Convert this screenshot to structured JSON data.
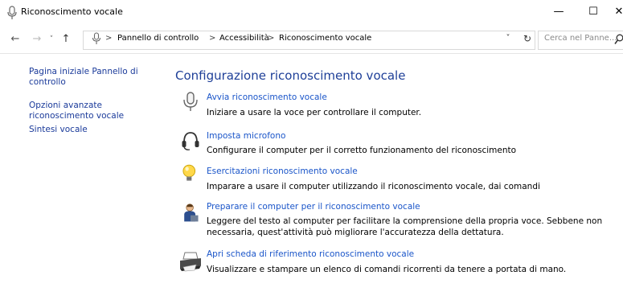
{
  "window": {
    "title": "Riconoscimento vocale",
    "controls": {
      "minimize": "—",
      "maximize": "☐",
      "close": "✕"
    }
  },
  "nav": {
    "back": "←",
    "forward": "→",
    "recent": "˅",
    "up": "↑"
  },
  "address": {
    "separator": ">",
    "crumbs": [
      "Pannello di controllo",
      "Accessibilità",
      "Riconoscimento vocale"
    ],
    "dropdown": "˅",
    "refresh": "↻"
  },
  "search": {
    "placeholder": "Cerca nel Panne..."
  },
  "sidebar": {
    "items": [
      {
        "label": "Pagina iniziale Pannello di controllo"
      },
      {
        "label": "Opzioni avanzate riconoscimento vocale"
      },
      {
        "label": "Sintesi vocale"
      }
    ]
  },
  "main": {
    "title": "Configurazione riconoscimento vocale",
    "tasks": [
      {
        "icon": "microphone-icon",
        "link": "Avvia riconoscimento vocale",
        "desc": "Iniziare a usare la voce per controllare il computer."
      },
      {
        "icon": "headset-icon",
        "link": "Imposta microfono",
        "desc": "Configurare il computer per il corretto funzionamento del riconoscimento"
      },
      {
        "icon": "lightbulb-icon",
        "link": "Esercitazioni riconoscimento vocale",
        "desc": "Imparare a usare il computer utilizzando il riconoscimento vocale, dai comandi"
      },
      {
        "icon": "user-speaking-icon",
        "link": "Preparare il computer per il riconoscimento vocale",
        "desc": "Leggere del testo al computer per facilitare la comprensione della propria voce. Sebbene non necessaria, quest'attività può migliorare l'accuratezza della dettatura."
      },
      {
        "icon": "printer-icon",
        "link": "Apri scheda di riferimento riconoscimento vocale",
        "desc": "Visualizzare e stampare un elenco di comandi ricorrenti da tenere a portata di mano."
      }
    ]
  }
}
